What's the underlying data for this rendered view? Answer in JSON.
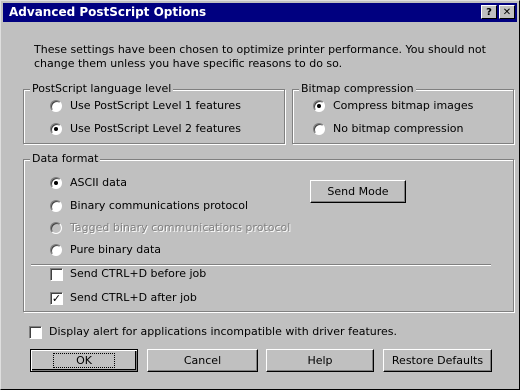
{
  "window": {
    "title": "Advanced PostScript Options",
    "help_btn": "?",
    "close_btn": "✕"
  },
  "intro_text": "These settings have been chosen to optimize printer performance. You should not change them unless you have specific reasons to do so.",
  "ps_level": {
    "legend": "PostScript language level",
    "options": [
      {
        "label": "Use PostScript Level 1 features",
        "checked": false
      },
      {
        "label": "Use PostScript Level 2 features",
        "checked": true
      }
    ]
  },
  "bitmap": {
    "legend": "Bitmap compression",
    "options": [
      {
        "label": "Compress bitmap images",
        "checked": true
      },
      {
        "label": "No bitmap compression",
        "checked": false
      }
    ]
  },
  "data_format": {
    "legend": "Data format",
    "options": [
      {
        "label": "ASCII data",
        "checked": true,
        "enabled": true
      },
      {
        "label": "Binary communications protocol",
        "checked": false,
        "enabled": true
      },
      {
        "label": "Tagged binary communications protocol",
        "checked": false,
        "enabled": false
      },
      {
        "label": "Pure binary data",
        "checked": false,
        "enabled": true
      }
    ],
    "send_mode": "Send Mode",
    "ctrl_d_before": {
      "label": "Send CTRL+D before job",
      "checked": false
    },
    "ctrl_d_after": {
      "label": "Send CTRL+D after job",
      "checked": true
    }
  },
  "display_alert": {
    "label": "Display alert for applications incompatible with driver features.",
    "checked": false
  },
  "buttons": {
    "ok": "OK",
    "cancel": "Cancel",
    "help": "Help",
    "restore": "Restore Defaults"
  },
  "colors": {
    "face": "#c0c0c0",
    "titlebar": "#000080",
    "disabled_text": "#808080"
  }
}
